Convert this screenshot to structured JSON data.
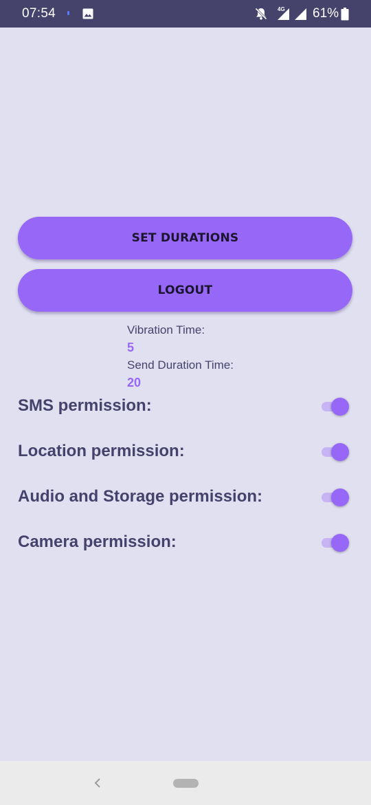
{
  "status_bar": {
    "time": "07:54",
    "network_label": "4G",
    "battery_percent": "61%",
    "icons": [
      "image-icon",
      "bell-off-icon",
      "signal-icon",
      "battery-icon"
    ]
  },
  "actions": {
    "set_durations_label": "SET DURATIONS",
    "logout_label": "LOGOUT"
  },
  "durations": {
    "vibration_label": "Vibration Time:",
    "vibration_value": "5",
    "send_label": "Send Duration Time:",
    "send_value": "20"
  },
  "permissions": [
    {
      "label": "SMS permission:",
      "enabled": true
    },
    {
      "label": "Location permission:",
      "enabled": true
    },
    {
      "label": "Audio and Storage permission:",
      "enabled": true
    },
    {
      "label": "Camera permission:",
      "enabled": true
    }
  ],
  "colors": {
    "background": "#e1e0f1",
    "status_bar": "#45426b",
    "accent": "#9767f8",
    "text": "#45426b",
    "nav_bar": "#ebebeb"
  },
  "nav_bar": {
    "icons": [
      "back-icon",
      "home-pill-icon"
    ]
  }
}
